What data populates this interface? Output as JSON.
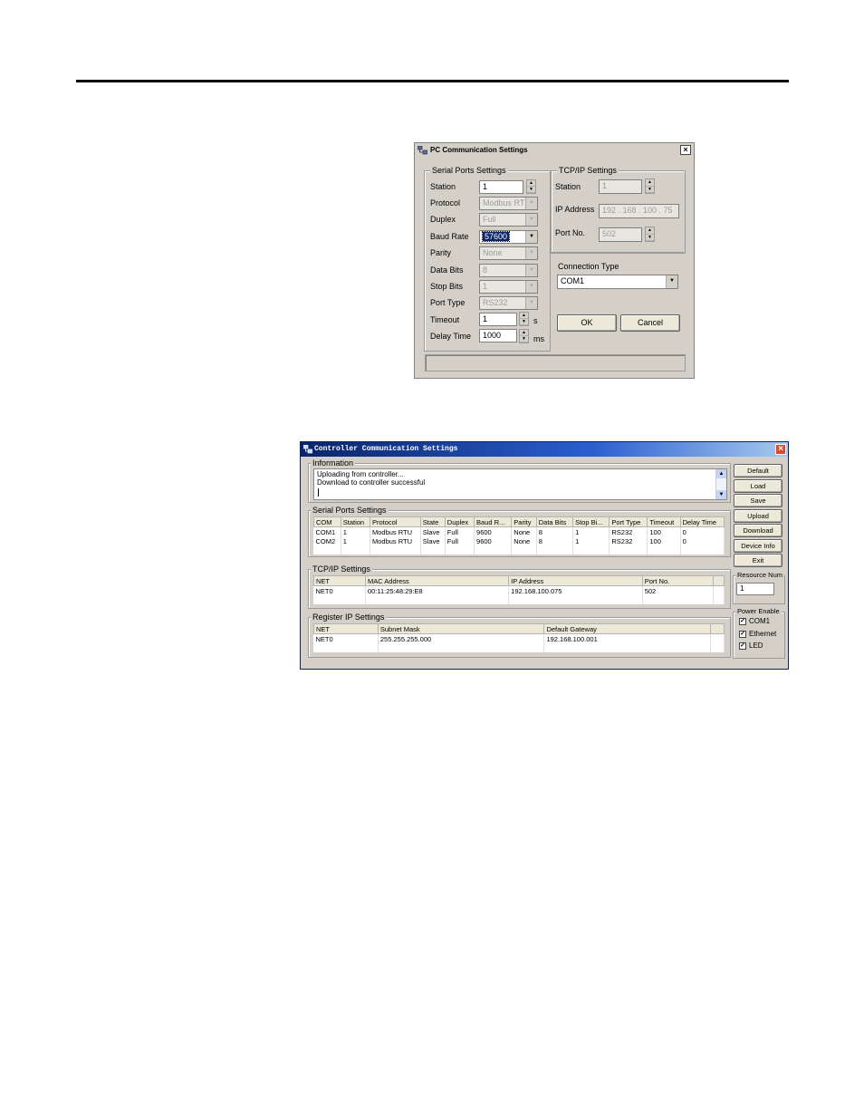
{
  "pc_dialog": {
    "title": "PC Communication Settings",
    "serial_group": "Serial Ports Settings",
    "tcp_group": "TCP/IP Settings",
    "labels": {
      "station": "Station",
      "protocol": "Protocol",
      "duplex": "Duplex",
      "baud_rate": "Baud Rate",
      "parity": "Parity",
      "data_bits": "Data Bits",
      "stop_bits": "Stop Bits",
      "port_type": "Port Type",
      "timeout": "Timeout",
      "delay_time": "Delay Time",
      "tcp_station": "Station",
      "ip_address": "IP Address",
      "port_no": "Port No.",
      "connection_type": "Connection Type"
    },
    "values": {
      "station": "1",
      "protocol": "Modbus RTU",
      "duplex": "Full",
      "baud_rate": "57600",
      "parity": "None",
      "data_bits": "8",
      "stop_bits": "1",
      "port_type": "RS232",
      "timeout": "1",
      "timeout_unit": "s",
      "delay_time": "1000",
      "delay_unit": "ms",
      "tcp_station": "1",
      "ip_address": "192 . 168 . 100 . 75",
      "port_no": "502",
      "connection_type": "COM1"
    },
    "buttons": {
      "ok": "OK",
      "cancel": "Cancel"
    }
  },
  "controller_dialog": {
    "title": "Controller Communication Settings",
    "information": {
      "label": "Information",
      "lines": [
        "Uploading from controller...",
        "Download to controller successful"
      ]
    },
    "serial": {
      "label": "Serial Ports Settings",
      "headers": [
        "COM",
        "Station",
        "Protocol",
        "State",
        "Duplex",
        "Baud R...",
        "Parity",
        "Data Bits",
        "Stop Bi...",
        "Port Type",
        "Timeout",
        "Delay Time"
      ],
      "rows": [
        [
          "COM1",
          "1",
          "Modbus RTU",
          "Slave",
          "Full",
          "9600",
          "None",
          "8",
          "1",
          "RS232",
          "100",
          "0"
        ],
        [
          "COM2",
          "1",
          "Modbus RTU",
          "Slave",
          "Full",
          "9600",
          "None",
          "8",
          "1",
          "RS232",
          "100",
          "0"
        ]
      ]
    },
    "tcp": {
      "label": "TCP/IP Settings",
      "headers": [
        "NET",
        "MAC Address",
        "IP Address",
        "Port No.",
        ""
      ],
      "rows": [
        [
          "NET0",
          "00:11:25:48:29:E8",
          "192.168.100.075",
          "502",
          ""
        ]
      ]
    },
    "register": {
      "label": "Register IP Settings",
      "headers": [
        "NET",
        "Subnet Mask",
        "Default Gateway",
        ""
      ],
      "rows": [
        [
          "NET0",
          "255.255.255.000",
          "192.168.100.001",
          ""
        ]
      ]
    },
    "buttons": [
      "Default",
      "Load",
      "Save",
      "Upload",
      "Download",
      "Device Info",
      "Exit"
    ],
    "resource_num": {
      "label": "Resource Num",
      "value": "1"
    },
    "power_enable": {
      "label": "Power Enable",
      "items": [
        "COM1",
        "Ethernet",
        "LED"
      ]
    }
  }
}
